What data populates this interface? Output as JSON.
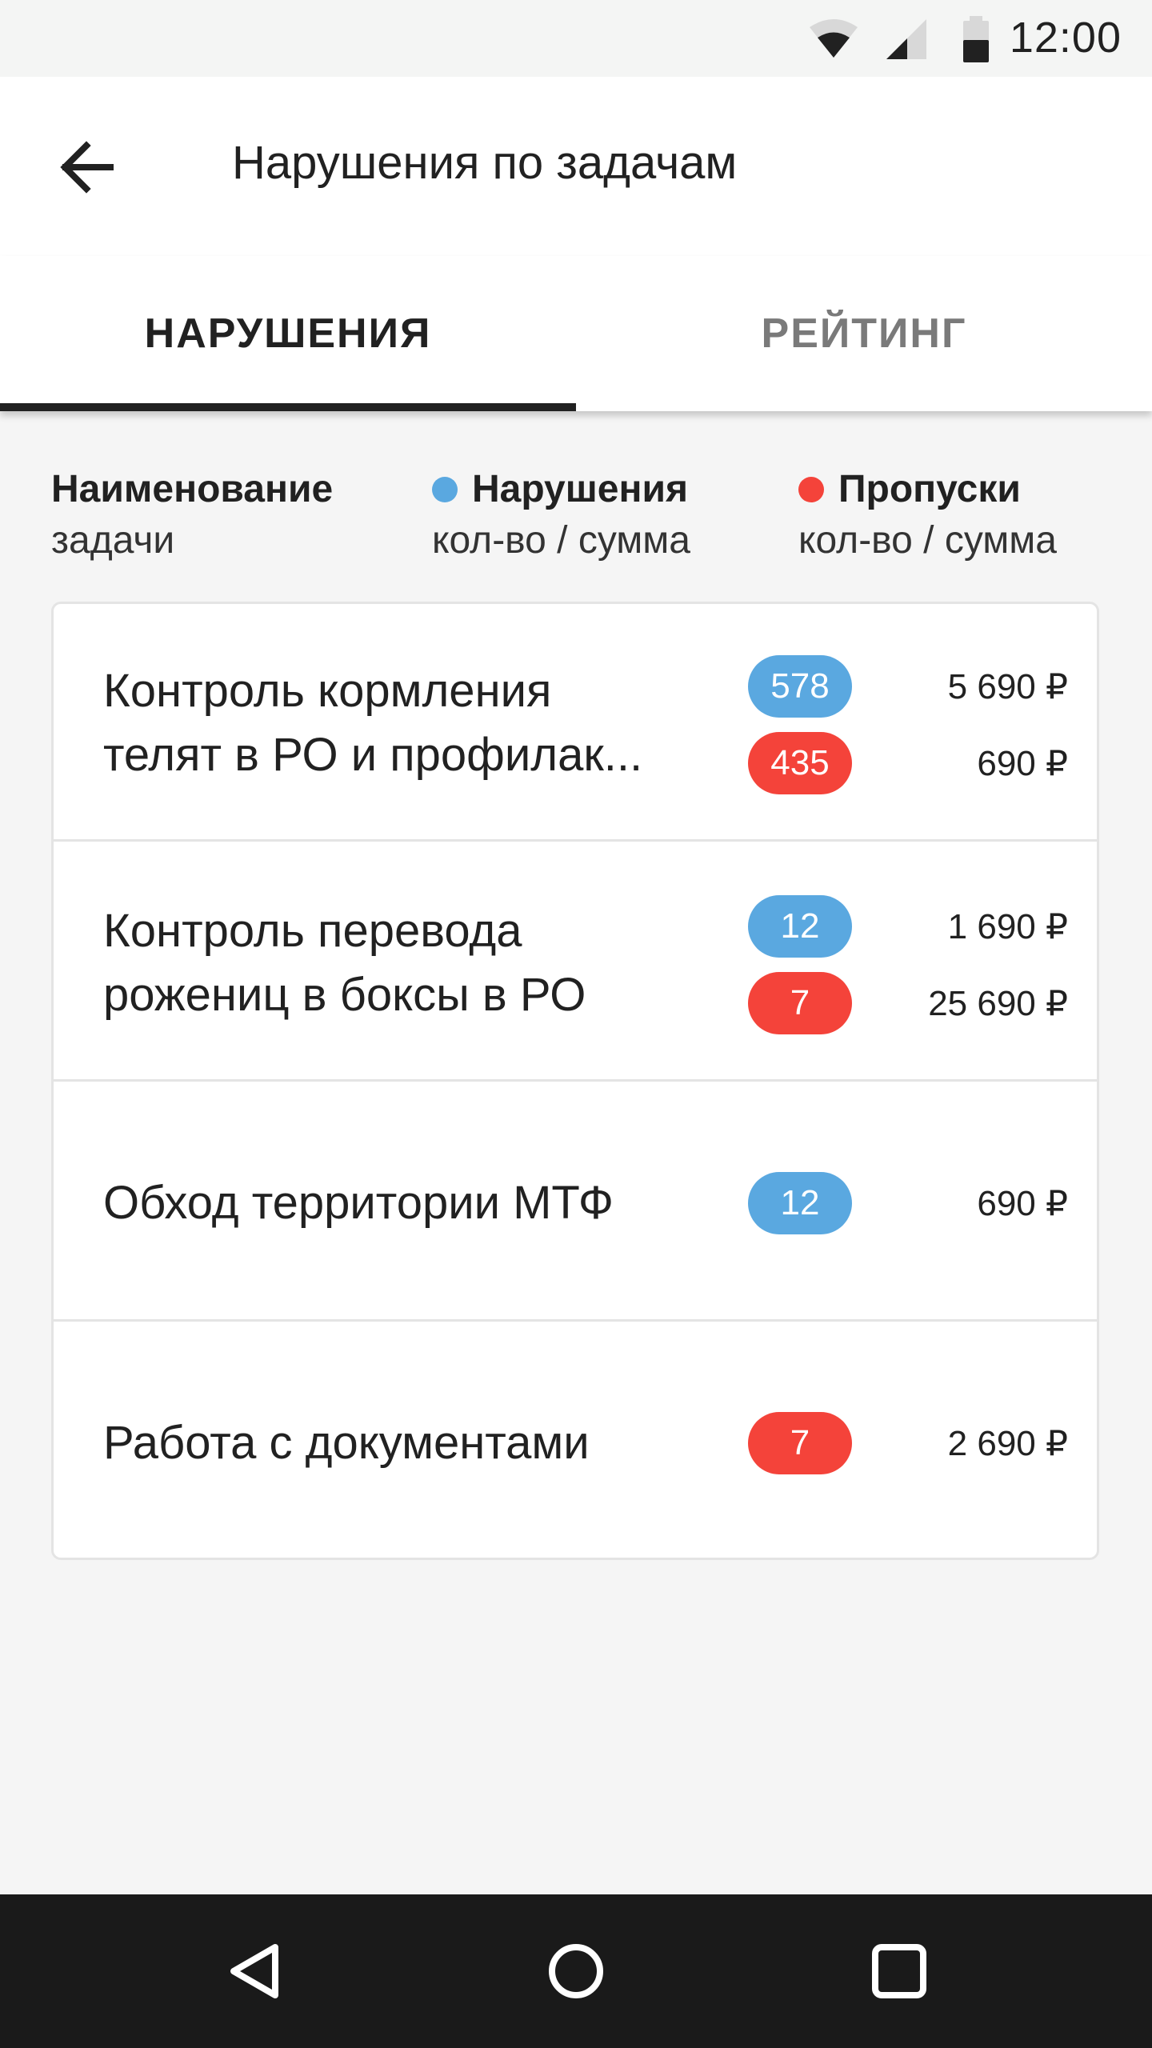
{
  "status_bar": {
    "time": "12:00"
  },
  "app_bar": {
    "title": "Нарушения по задачам"
  },
  "tabs": [
    {
      "label": "НАРУШЕНИЯ",
      "active": true
    },
    {
      "label": "РЕЙТИНГ",
      "active": false
    }
  ],
  "columns": {
    "name": {
      "title": "Наименование",
      "subtitle": "задачи"
    },
    "violations": {
      "title": "Нарушения",
      "subtitle": "кол-во / сумма"
    },
    "misses": {
      "title": "Пропуски",
      "subtitle": "кол-во / сумма"
    }
  },
  "colors": {
    "violations": "#5aa8e0",
    "misses": "#f4433a",
    "divider": "#e4e4e4"
  },
  "tasks": [
    {
      "name_line1": "Контроль кормления",
      "name_line2": "телят в РО и профилак...",
      "violations": {
        "count": "578",
        "sum": "5 690 ₽"
      },
      "misses": {
        "count": "435",
        "sum": "690 ₽"
      }
    },
    {
      "name_line1": "Контроль перевода",
      "name_line2": "рожениц в боксы в РО",
      "violations": {
        "count": "12",
        "sum": "1 690 ₽"
      },
      "misses": {
        "count": "7",
        "sum": "25 690 ₽"
      }
    },
    {
      "name_line1": "Обход территории МТФ",
      "name_line2": "",
      "violations": {
        "count": "12",
        "sum": "690 ₽"
      }
    },
    {
      "name_line1": "Работа с документами",
      "name_line2": "",
      "misses": {
        "count": "7",
        "sum": "2 690 ₽"
      }
    }
  ],
  "icons": {
    "back": "arrow-back-icon",
    "wifi": "wifi-icon",
    "signal": "cell-signal-icon",
    "battery": "battery-icon",
    "nav_back": "nav-back-icon",
    "nav_home": "nav-home-icon",
    "nav_recents": "nav-recents-icon"
  }
}
